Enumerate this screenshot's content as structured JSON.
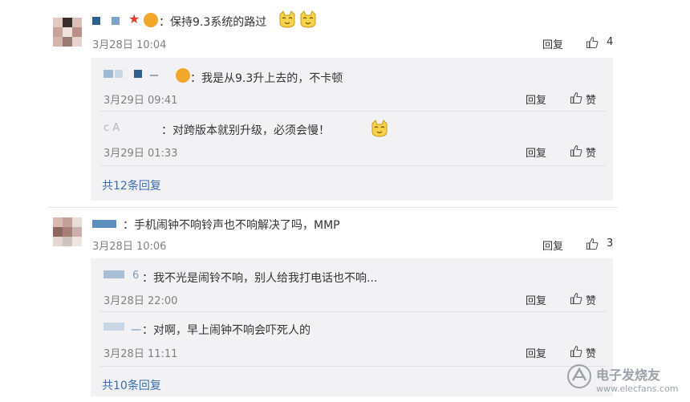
{
  "comments": [
    {
      "text": "：保持9.3系统的路过",
      "time": "3月28日 10:04",
      "reply_label": "回复",
      "like_count": "4",
      "replies": [
        {
          "name_fragment": "",
          "text": "：我是从9.3升上去的，不卡顿",
          "time": "3月29日 09:41",
          "reply_label": "回复",
          "like_label": "赞"
        },
        {
          "name_fragment": "c            A",
          "text": "：对跨版本就别升级，必须会慢！",
          "time": "3月29日 01:33",
          "reply_label": "回复",
          "like_label": "赞"
        }
      ],
      "more_replies": "共12条回复"
    },
    {
      "text": "：手机闹钟不响铃声也不响解决了吗，MMP",
      "time": "3月28日 10:06",
      "reply_label": "回复",
      "like_count": "3",
      "replies": [
        {
          "name_fragment": "6",
          "text": "：我不光是闹铃不响，别人给我打电话也不响...",
          "time": "3月28日 22:00",
          "reply_label": "回复",
          "like_label": "赞"
        },
        {
          "name_fragment": "一",
          "text": "：对啊，早上闹钟不响会吓死人的",
          "time": "3月28日 11:11",
          "reply_label": "回复",
          "like_label": "赞"
        }
      ],
      "more_replies": "共10条回复"
    }
  ],
  "watermark": {
    "title": "电子发烧友",
    "url": "www.elecfans.com"
  },
  "colors": {
    "link": "#3b6bb0",
    "reply_bg": "#f2f2f5",
    "timestamp": "#808080"
  }
}
